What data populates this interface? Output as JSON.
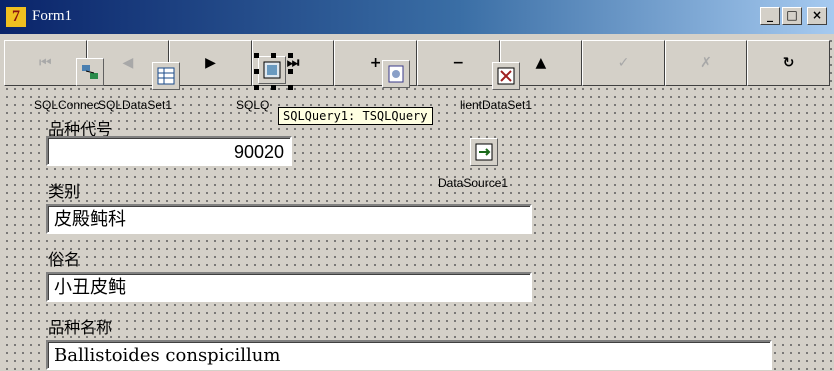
{
  "window": {
    "title": "Form1",
    "icon": "delphi-7-icon"
  },
  "caption_buttons": {
    "minimize": "_",
    "maximize": "□",
    "close": "×"
  },
  "navigator": {
    "buttons": [
      {
        "name": "first",
        "glyph": "⏮",
        "enabled": false
      },
      {
        "name": "prior",
        "glyph": "◀",
        "enabled": false
      },
      {
        "name": "next",
        "glyph": "▶",
        "enabled": true
      },
      {
        "name": "last",
        "glyph": "⏭",
        "enabled": true
      },
      {
        "name": "insert",
        "glyph": "+",
        "enabled": true
      },
      {
        "name": "delete",
        "glyph": "−",
        "enabled": true
      },
      {
        "name": "edit",
        "glyph": "▲",
        "enabled": true
      },
      {
        "name": "post",
        "glyph": "✓",
        "enabled": false
      },
      {
        "name": "cancel",
        "glyph": "✗",
        "enabled": false
      },
      {
        "name": "refresh",
        "glyph": "↻",
        "enabled": true
      }
    ]
  },
  "components": [
    {
      "label": "SQLConnec",
      "icon": "sql-connection-icon"
    },
    {
      "label": "SQLDataSet1",
      "icon": "sql-dataset-icon"
    },
    {
      "label": "SQLQ",
      "icon": "sql-query-icon"
    },
    {
      "label": "",
      "icon": "dataset-provider-icon"
    },
    {
      "label": "lientDataSet1",
      "icon": "client-dataset-icon"
    },
    {
      "label": "DataSource1",
      "icon": "datasource-icon"
    }
  ],
  "hint": "SQLQuery1: TSQLQuery",
  "fields": [
    {
      "label": "品种代号",
      "value": "90020"
    },
    {
      "label": "类别",
      "value": "皮殿鲀科"
    },
    {
      "label": "俗名",
      "value": "小丑皮鲀"
    },
    {
      "label": "品种名称",
      "value": "Ballistoides conspicillum"
    }
  ]
}
